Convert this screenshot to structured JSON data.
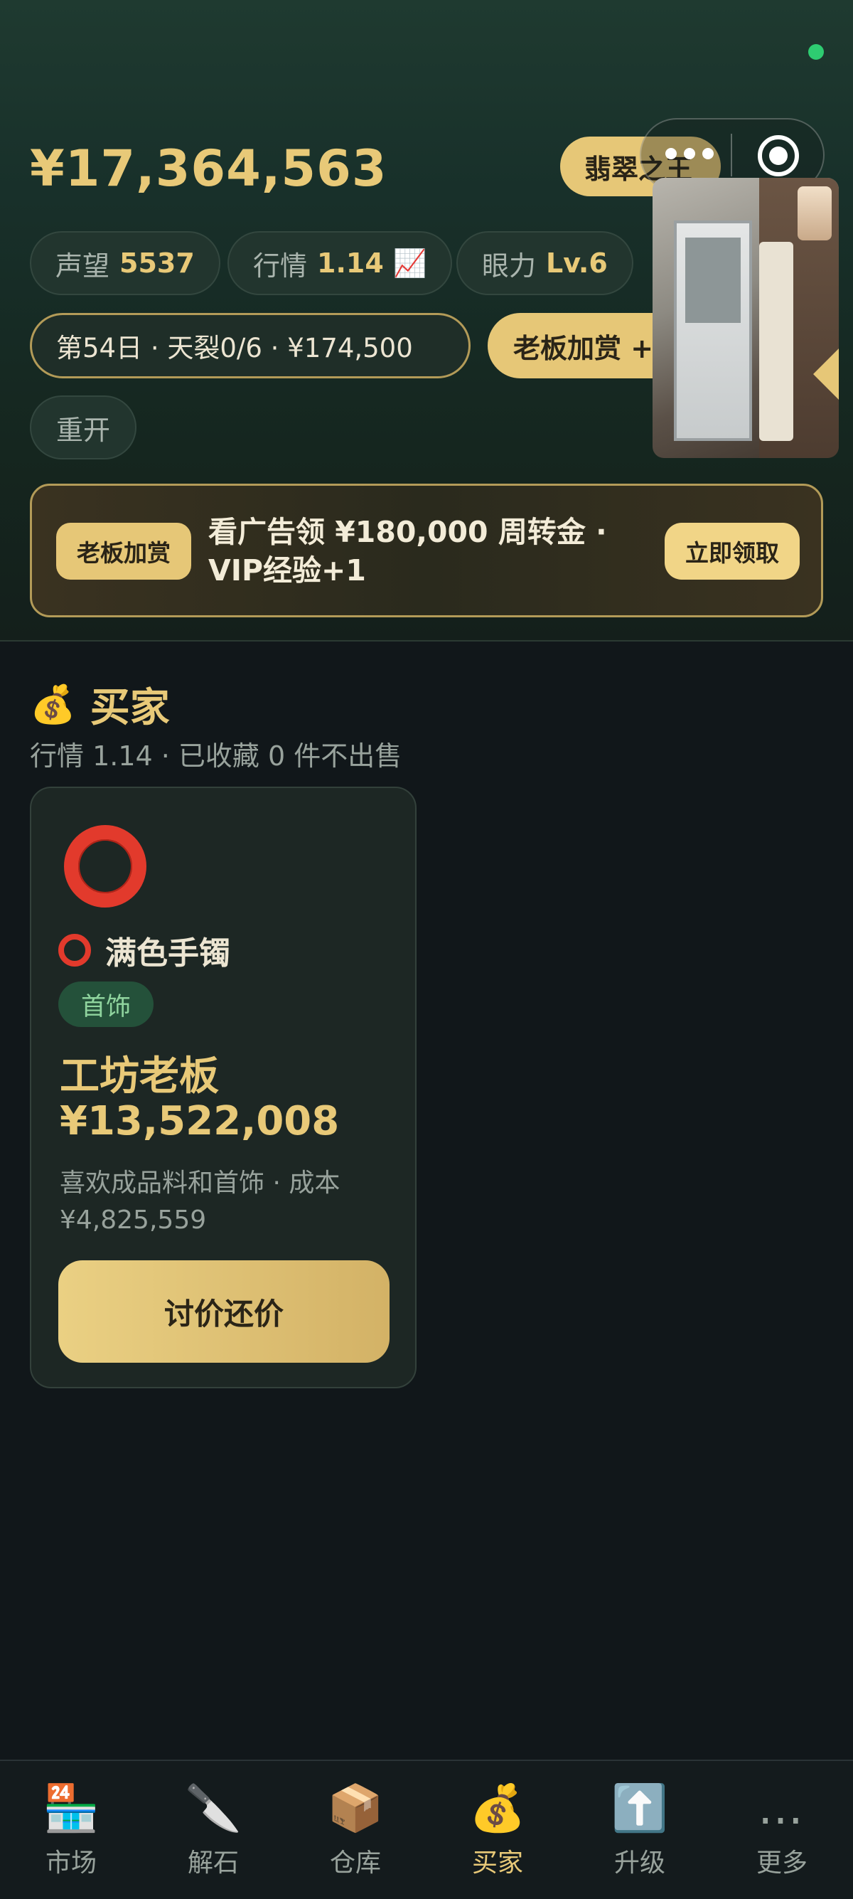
{
  "header": {
    "balance": "¥17,364,563",
    "title_badge": "翡翠之王",
    "stats": [
      {
        "label": "声望",
        "value": "5537"
      },
      {
        "label": "行情",
        "value": "1.14 📈"
      },
      {
        "label": "眼力",
        "value": "Lv.6"
      }
    ],
    "day_info": "第54日 · 天裂0/6 · ¥174,500",
    "bonus_button": "老板加赏 +",
    "restart_button": "重开"
  },
  "banner": {
    "tag": "老板加赏",
    "text": "看广告领 ¥180,000 周转金 · VIP经验+1",
    "claim_button": "立即领取"
  },
  "section": {
    "icon": "💰",
    "title": "买家",
    "subtitle": "行情 1.14 · 已收藏 0 件不出售"
  },
  "card": {
    "item_icon_small": "⭕",
    "item_name": "满色手镯",
    "category_tag": "首饰",
    "buyer_name": "工坊老板",
    "offer_price": "¥13,522,008",
    "description": "喜欢成品料和首饰 · 成本 ¥4,825,559",
    "haggle_button": "讨价还价"
  },
  "nav": [
    {
      "icon": "🏪",
      "label": "市场"
    },
    {
      "icon": "🔪",
      "label": "解石"
    },
    {
      "icon": "📦",
      "label": "仓库"
    },
    {
      "icon": "💰",
      "label": "买家"
    },
    {
      "icon": "⬆️",
      "label": "升级"
    },
    {
      "icon": "…",
      "label": "更多"
    }
  ],
  "colors": {
    "accent_gold": "#e8c978",
    "status_green": "#2ecc71",
    "bracelet_red": "#e23a2c"
  }
}
